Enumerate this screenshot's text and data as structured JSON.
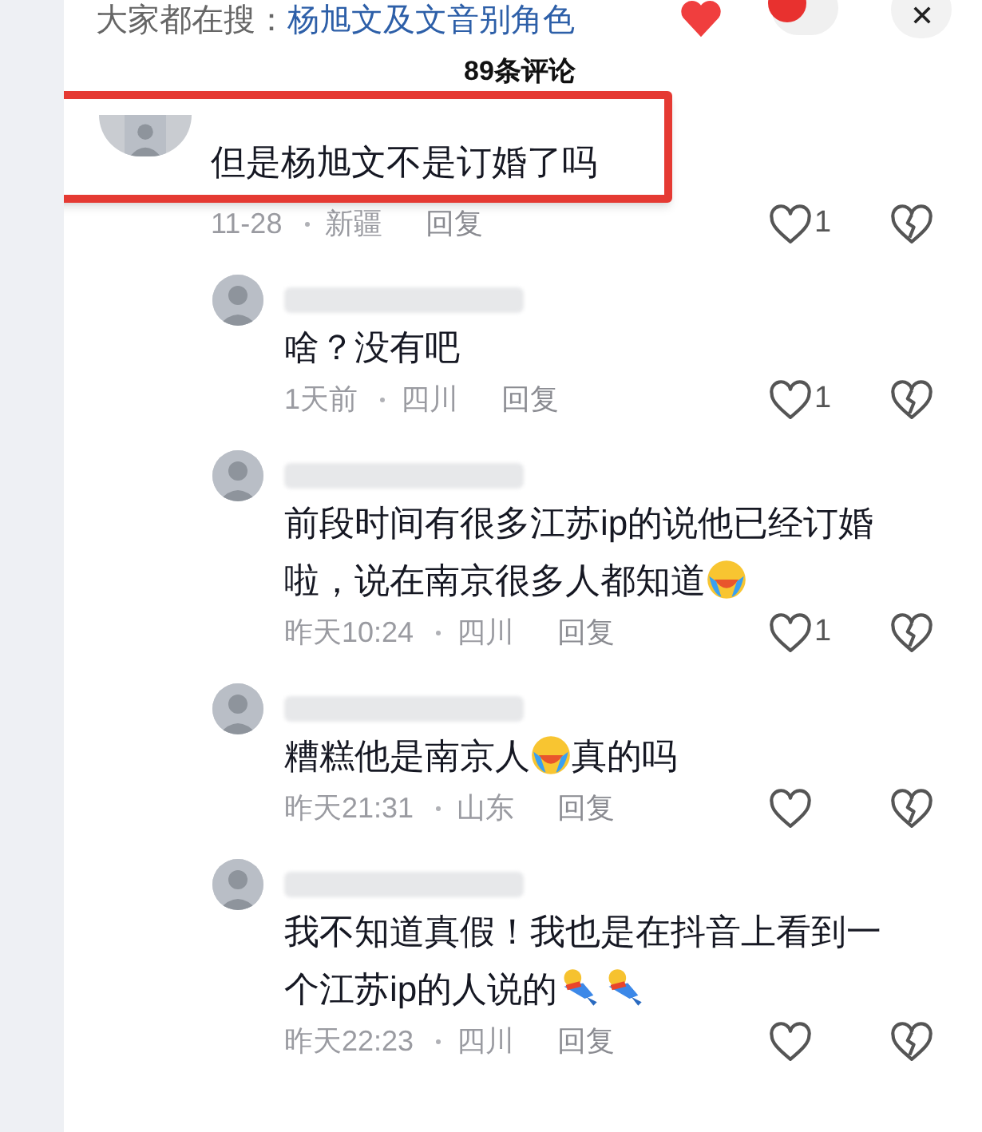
{
  "search_hint": {
    "label": "大家都在搜：",
    "query": "杨旭文及文音别角色"
  },
  "header": {
    "title": "89条评论"
  },
  "comments": [
    {
      "content": [
        {
          "kind": "text",
          "text": "但是杨旭文不是订婚了吗"
        }
      ],
      "time": "11-28",
      "location": "新疆",
      "reply": "回复",
      "likes": "1",
      "liked": false,
      "highlighted": true,
      "children": [
        {
          "content": [
            {
              "kind": "text",
              "text": "啥？没有吧"
            }
          ],
          "time": "1天前",
          "location": "四川",
          "reply": "回复",
          "likes": "1",
          "liked": false
        },
        {
          "content": [
            {
              "kind": "text",
              "text": "前段时间有很多江苏ip的说他已经订婚啦，说在南京很多人都知道"
            },
            {
              "kind": "laugh-cry"
            }
          ],
          "time": "昨天10:24",
          "location": "四川",
          "reply": "回复",
          "likes": "1",
          "liked": false
        },
        {
          "content": [
            {
              "kind": "text",
              "text": "糟糕他是南京人"
            },
            {
              "kind": "laugh-cry"
            },
            {
              "kind": "text",
              "text": "真的吗"
            }
          ],
          "time": "昨天21:31",
          "location": "山东",
          "reply": "回复",
          "liked": false
        },
        {
          "content": [
            {
              "kind": "text",
              "text": "我不知道真假！我也是在抖音上看到一个江苏ip的人说的"
            },
            {
              "kind": "tumble"
            },
            {
              "kind": "tumble"
            }
          ],
          "time": "昨天22:23",
          "location": "四川",
          "reply": "回复",
          "liked": false
        }
      ]
    }
  ]
}
